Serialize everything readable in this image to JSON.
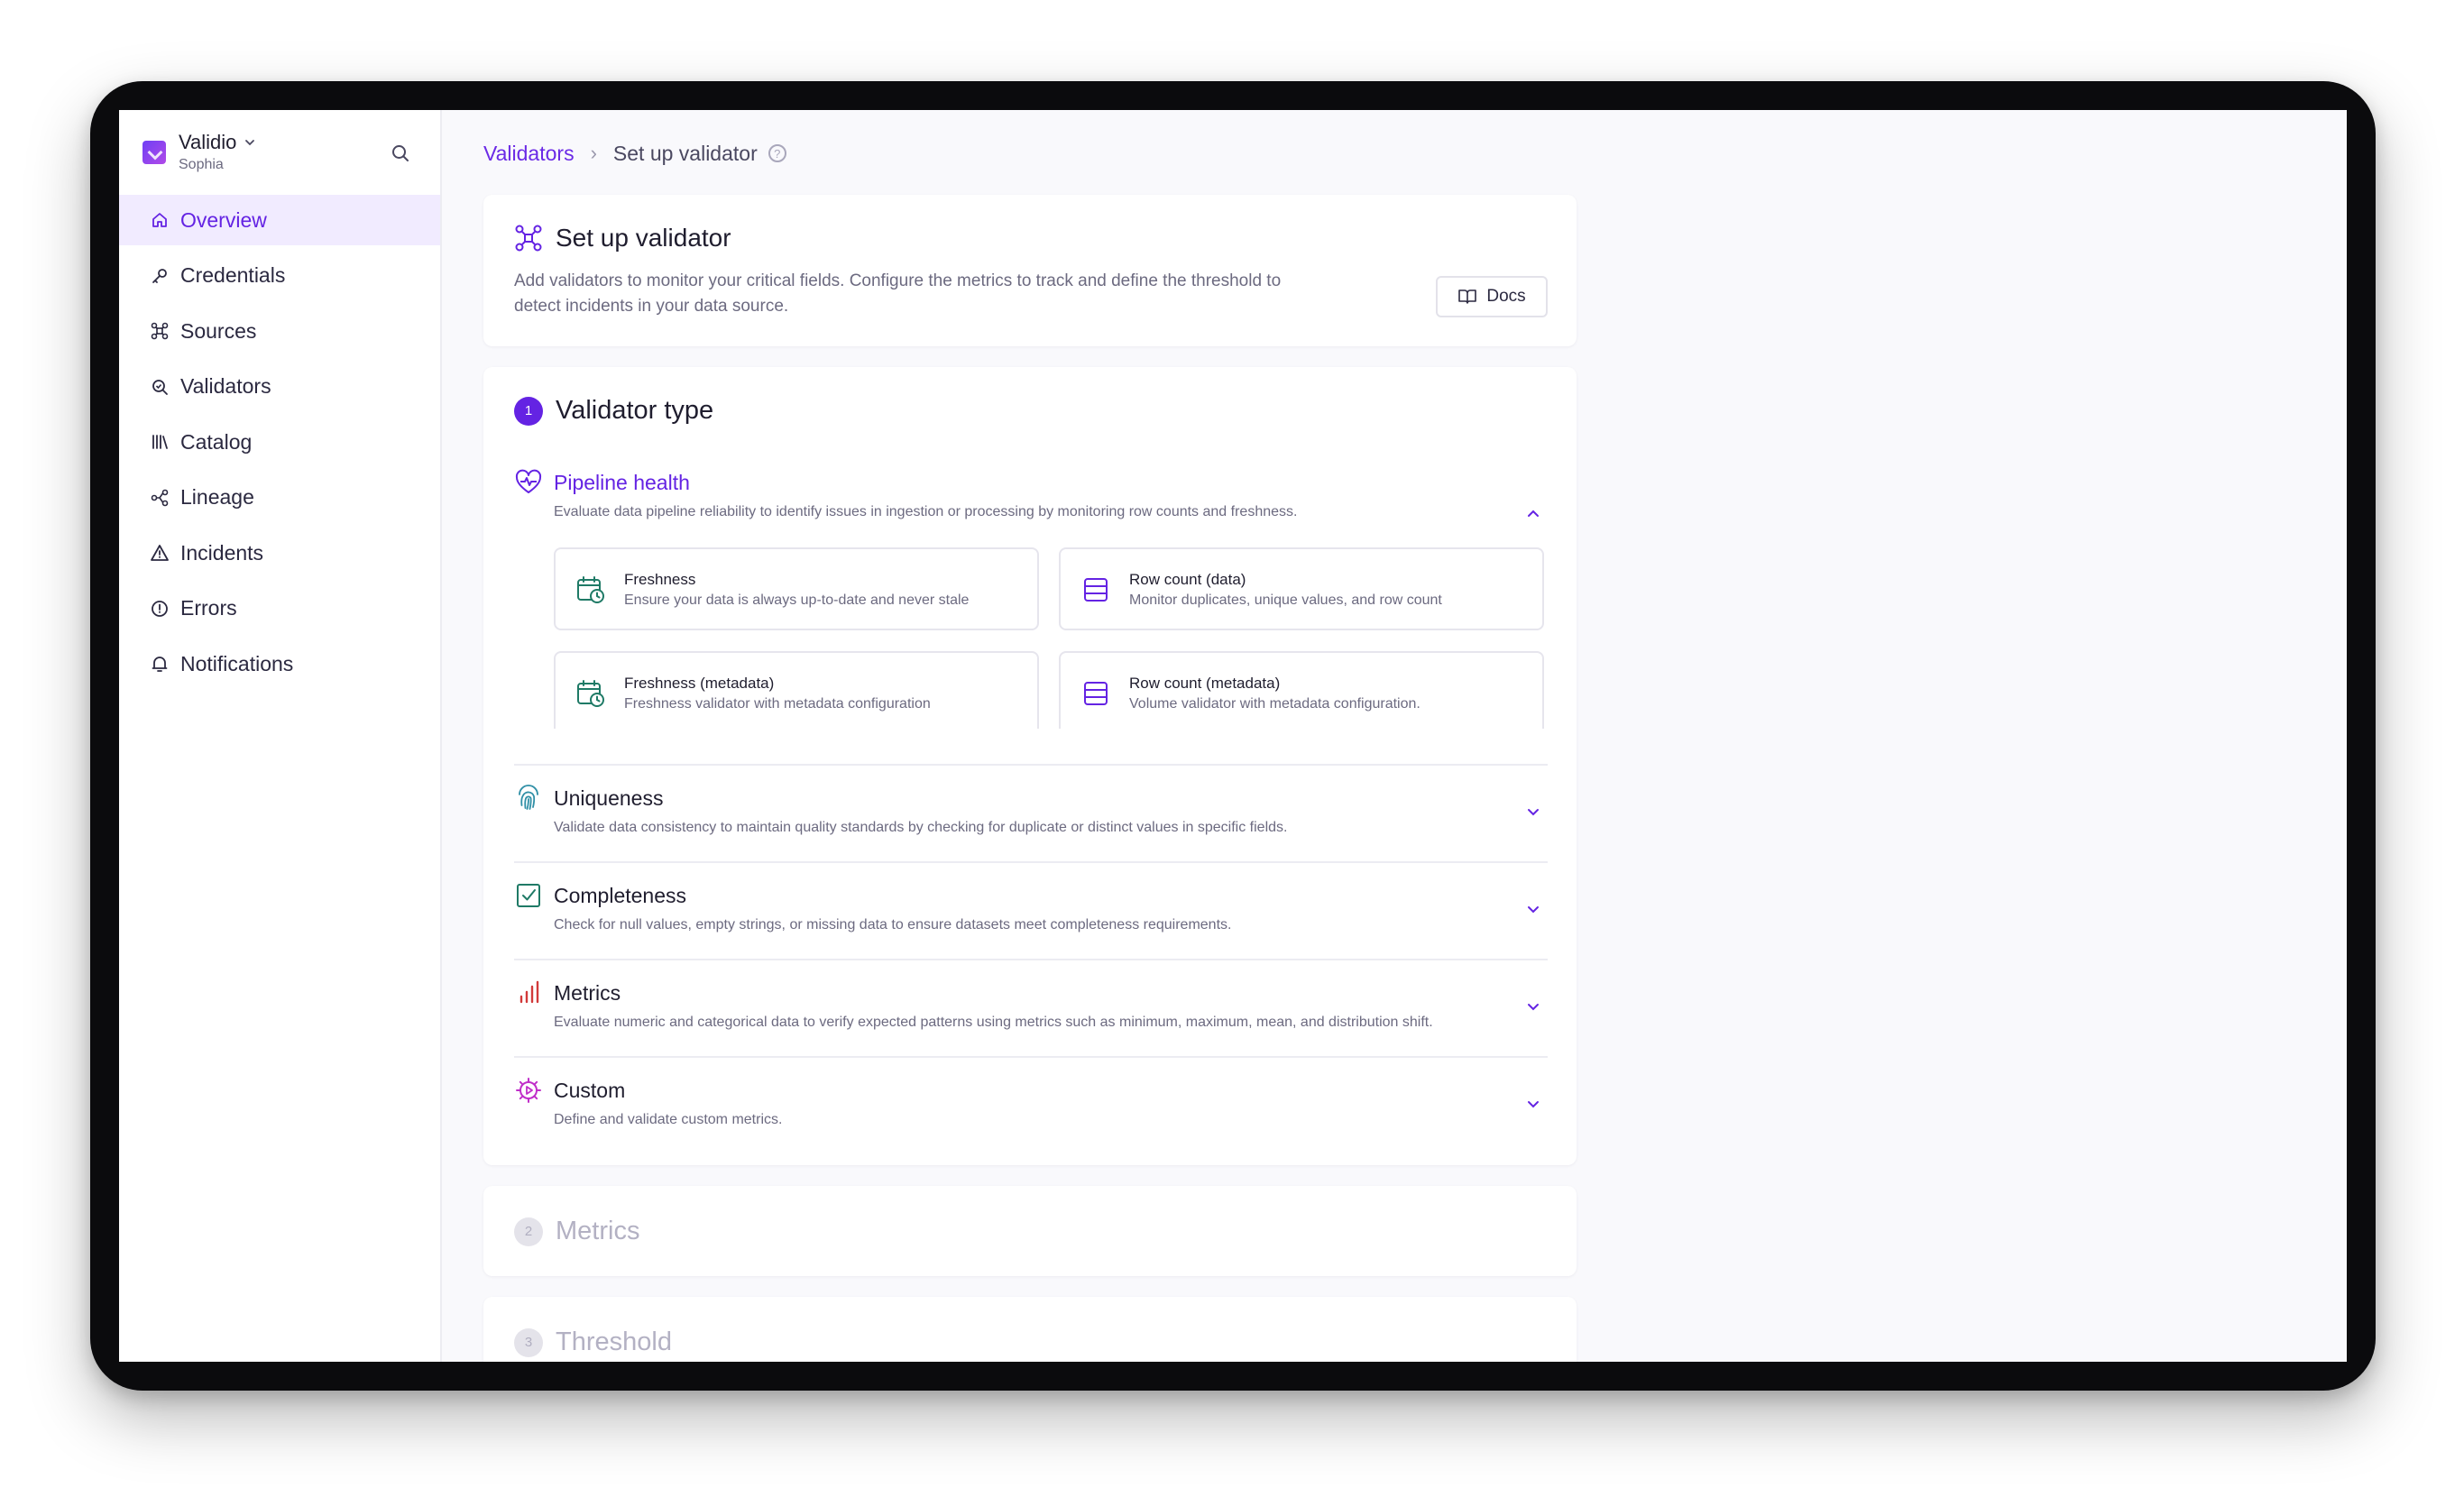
{
  "workspace": {
    "name": "Validio",
    "user": "Sophia"
  },
  "sidebar": {
    "items": [
      {
        "label": "Overview",
        "icon": "home-icon",
        "active": true
      },
      {
        "label": "Credentials",
        "icon": "key-icon"
      },
      {
        "label": "Sources",
        "icon": "sources-icon"
      },
      {
        "label": "Validators",
        "icon": "validators-icon"
      },
      {
        "label": "Catalog",
        "icon": "catalog-icon"
      },
      {
        "label": "Lineage",
        "icon": "lineage-icon"
      },
      {
        "label": "Incidents",
        "icon": "warning-icon"
      },
      {
        "label": "Errors",
        "icon": "error-icon"
      },
      {
        "label": "Notifications",
        "icon": "bell-icon"
      }
    ]
  },
  "breadcrumb": {
    "parent": "Validators",
    "current": "Set up validator"
  },
  "header": {
    "title": "Set up validator",
    "description": "Add validators to monitor your critical fields. Configure the metrics to track and define the threshold to detect incidents in your data source.",
    "docs_label": "Docs"
  },
  "steps": [
    {
      "number": "1",
      "label": "Validator type"
    },
    {
      "number": "2",
      "label": "Metrics"
    },
    {
      "number": "3",
      "label": "Threshold"
    }
  ],
  "categories": [
    {
      "title": "Pipeline health",
      "description": "Evaluate data pipeline reliability to identify issues in ingestion or processing by monitoring row counts and freshness.",
      "expanded": true,
      "options": [
        {
          "title": "Freshness",
          "description": "Ensure your data is always up-to-date and never stale"
        },
        {
          "title": "Row count (data)",
          "description": "Monitor duplicates, unique values, and row count"
        },
        {
          "title": "Freshness (metadata)",
          "description": "Freshness validator with metadata configuration"
        },
        {
          "title": "Row count (metadata)",
          "description": "Volume validator with metadata configuration."
        }
      ]
    },
    {
      "title": "Uniqueness",
      "description": "Validate data consistency to maintain quality standards by checking for duplicate or distinct values in specific fields."
    },
    {
      "title": "Completeness",
      "description": "Check for null values, empty strings, or missing data to ensure datasets meet completeness requirements."
    },
    {
      "title": "Metrics",
      "description": "Evaluate numeric and categorical data to verify expected patterns using metrics such as minimum, maximum, mean, and distribution shift."
    },
    {
      "title": "Custom",
      "description": "Define and validate custom metrics."
    }
  ],
  "colors": {
    "accent": "#6423e3",
    "teal": "#1f7a66",
    "cyan": "#2f8fa6",
    "red": "#d23a3a",
    "magenta": "#c02fc9"
  }
}
